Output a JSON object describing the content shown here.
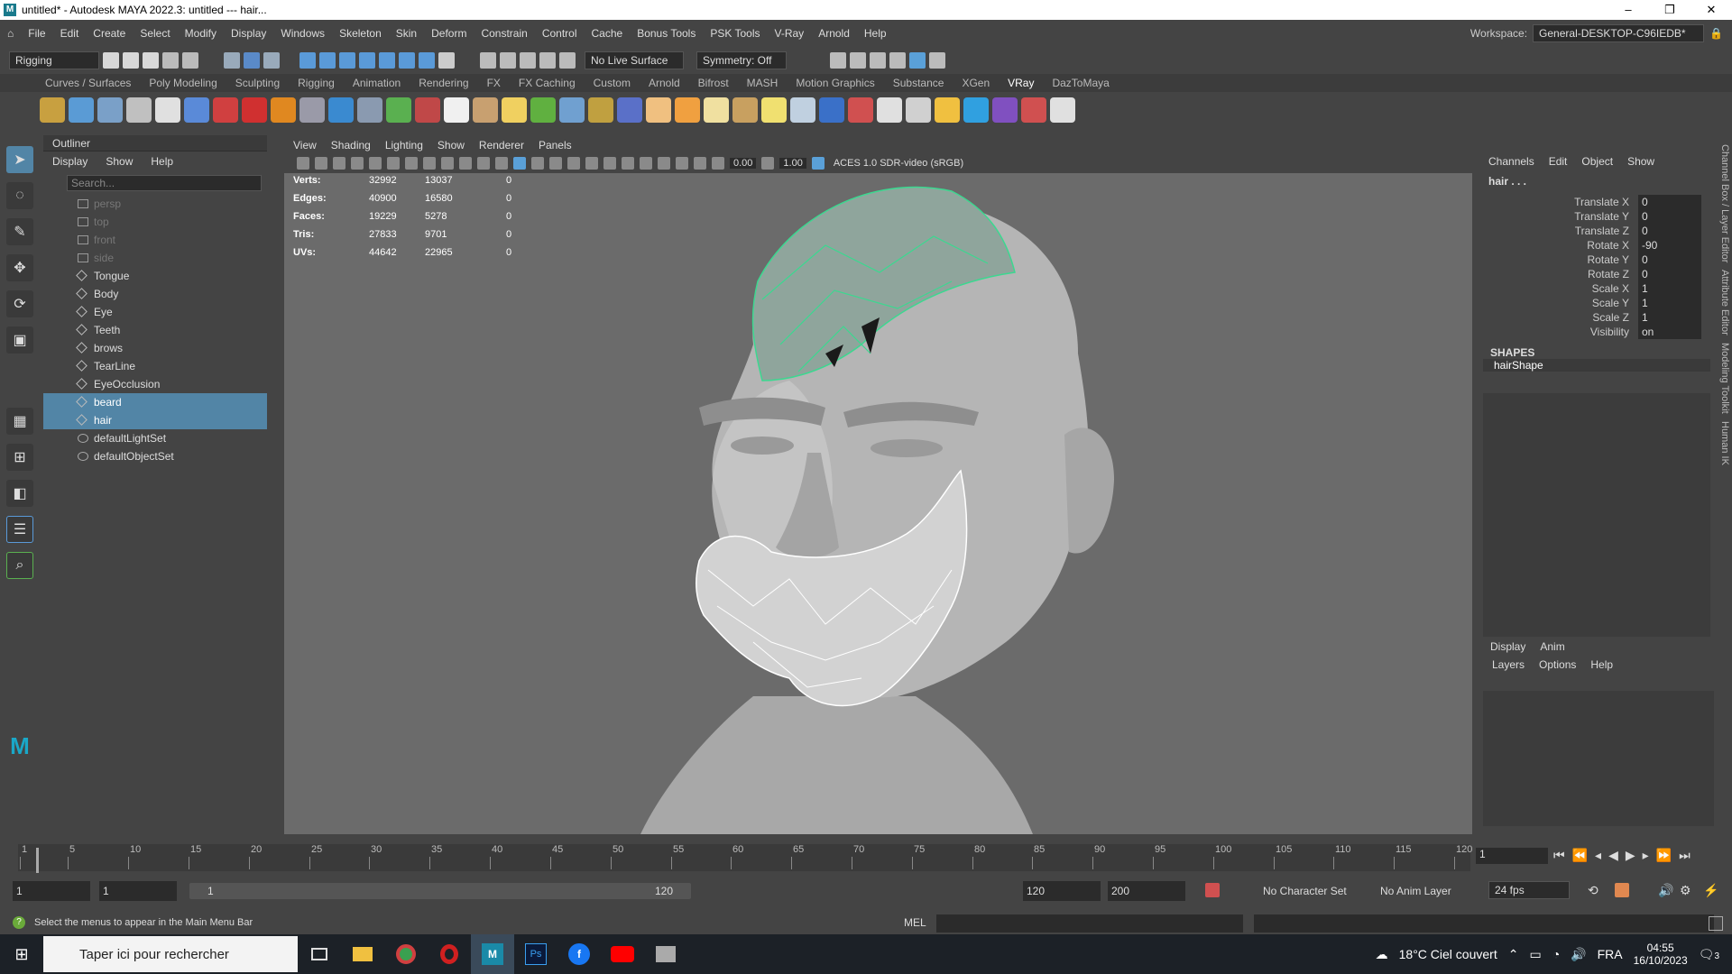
{
  "titlebar": {
    "title": "untitled* - Autodesk MAYA 2022.3: untitled   ---   hair...",
    "logo": "M"
  },
  "menubar": {
    "items": [
      "File",
      "Edit",
      "Create",
      "Select",
      "Modify",
      "Display",
      "Windows",
      "Skeleton",
      "Skin",
      "Deform",
      "Constrain",
      "Control",
      "Cache",
      "Bonus Tools",
      "PSK Tools",
      "V-Ray",
      "Arnold",
      "Help"
    ],
    "workspace_label": "Workspace:",
    "workspace_value": "General-DESKTOP-C96IEDB*"
  },
  "statusline": {
    "menuset": "Rigging",
    "live_surface": "No Live Surface",
    "symmetry": "Symmetry: Off"
  },
  "shelf": {
    "tabs": [
      "Curves / Surfaces",
      "Poly Modeling",
      "Sculpting",
      "Rigging",
      "Animation",
      "Rendering",
      "FX",
      "FX Caching",
      "Custom",
      "Arnold",
      "Bifrost",
      "MASH",
      "Motion Graphics",
      "Substance",
      "XGen",
      "VRay",
      "DazToMaya"
    ],
    "active": "VRay",
    "icon_colors": [
      "#c8a040",
      "#5a9bd5",
      "#7aa0c8",
      "#c0c0c0",
      "#e0e0e0",
      "#5a8ad8",
      "#d04040",
      "#d03030",
      "#e08820",
      "#9a9aa8",
      "#3a8ad0",
      "#8a9ab0",
      "#5ab050",
      "#c04848",
      "#f0f0f0",
      "#c8a070",
      "#f0d060",
      "#60b040",
      "#70a0d0",
      "#c0a040",
      "#5a70c8",
      "#f0c080",
      "#f0a040",
      "#f0e0a0",
      "#c8a060",
      "#f0e070",
      "#c0d0e0",
      "#3a70c8",
      "#d05050",
      "#e0e0e0",
      "#d0d0d0",
      "#f0c040",
      "#30a0e0",
      "#8050c0",
      "#d05050",
      "#e0e0e0"
    ]
  },
  "outliner": {
    "title": "Outliner",
    "menu": [
      "Display",
      "Show",
      "Help"
    ],
    "search_placeholder": "Search...",
    "items": [
      {
        "label": "persp",
        "type": "camera",
        "dim": true,
        "selected": false
      },
      {
        "label": "top",
        "type": "camera",
        "dim": true,
        "selected": false
      },
      {
        "label": "front",
        "type": "camera",
        "dim": true,
        "selected": false
      },
      {
        "label": "side",
        "type": "camera",
        "dim": true,
        "selected": false
      },
      {
        "label": "Tongue",
        "type": "mesh",
        "dim": false,
        "selected": false
      },
      {
        "label": "Body",
        "type": "mesh",
        "dim": false,
        "selected": false
      },
      {
        "label": "Eye",
        "type": "mesh",
        "dim": false,
        "selected": false
      },
      {
        "label": "Teeth",
        "type": "mesh",
        "dim": false,
        "selected": false
      },
      {
        "label": "brows",
        "type": "mesh",
        "dim": false,
        "selected": false
      },
      {
        "label": "TearLine",
        "type": "mesh",
        "dim": false,
        "selected": false
      },
      {
        "label": "EyeOcclusion",
        "type": "mesh",
        "dim": false,
        "selected": false
      },
      {
        "label": "beard",
        "type": "mesh",
        "dim": false,
        "selected": true
      },
      {
        "label": "hair",
        "type": "mesh",
        "dim": false,
        "selected": true
      },
      {
        "label": "defaultLightSet",
        "type": "set",
        "dim": false,
        "selected": false
      },
      {
        "label": "defaultObjectSet",
        "type": "set",
        "dim": false,
        "selected": false
      }
    ]
  },
  "viewport": {
    "menu": [
      "View",
      "Shading",
      "Lighting",
      "Show",
      "Renderer",
      "Panels"
    ],
    "exposure": "0.00",
    "gamma": "1.00",
    "color_space": "ACES 1.0 SDR-video (sRGB)",
    "hud": [
      {
        "label": "Verts:",
        "v1": "32992",
        "v2": "13037",
        "v3": "0"
      },
      {
        "label": "Edges:",
        "v1": "40900",
        "v2": "16580",
        "v3": "0"
      },
      {
        "label": "Faces:",
        "v1": "19229",
        "v2": "5278",
        "v3": "0"
      },
      {
        "label": "Tris:",
        "v1": "27833",
        "v2": "9701",
        "v3": "0"
      },
      {
        "label": "UVs:",
        "v1": "44642",
        "v2": "22965",
        "v3": "0"
      }
    ]
  },
  "channelbox": {
    "menu": [
      "Channels",
      "Edit",
      "Object",
      "Show"
    ],
    "object": "hair . . .",
    "attrs": [
      {
        "name": "Translate X",
        "value": "0"
      },
      {
        "name": "Translate Y",
        "value": "0"
      },
      {
        "name": "Translate Z",
        "value": "0"
      },
      {
        "name": "Rotate X",
        "value": "-90"
      },
      {
        "name": "Rotate Y",
        "value": "0"
      },
      {
        "name": "Rotate Z",
        "value": "0"
      },
      {
        "name": "Scale X",
        "value": "1"
      },
      {
        "name": "Scale Y",
        "value": "1"
      },
      {
        "name": "Scale Z",
        "value": "1"
      },
      {
        "name": "Visibility",
        "value": "on"
      }
    ],
    "shapes_label": "SHAPES",
    "shape_name": "hairShape"
  },
  "layereditor": {
    "tabs": [
      "Display",
      "Anim"
    ],
    "menu": [
      "Layers",
      "Options",
      "Help"
    ]
  },
  "sidetabs": [
    "Channel Box / Layer Editor",
    "Attribute Editor",
    "Modeling Toolkit",
    "Human IK"
  ],
  "timeline": {
    "ticks": [
      "1",
      "5",
      "10",
      "15",
      "20",
      "25",
      "30",
      "35",
      "40",
      "45",
      "50",
      "55",
      "60",
      "65",
      "70",
      "75",
      "80",
      "85",
      "90",
      "95",
      "100",
      "105",
      "110",
      "115",
      "120"
    ],
    "current_frame": "1"
  },
  "range": {
    "start": "1",
    "start_inner": "1",
    "slider_start": "1",
    "slider_end": "120",
    "end_inner": "120",
    "end": "200",
    "character_set": "No Character Set",
    "anim_layer": "No Anim Layer",
    "fps": "24 fps"
  },
  "cmdline": {
    "help_text": "Select the menus to appear in the Main Menu Bar",
    "lang": "MEL"
  },
  "taskbar": {
    "search_placeholder": "Taper ici pour rechercher",
    "weather": "18°C  Ciel couvert",
    "lang": "FRA",
    "time": "04:55",
    "date": "16/10/2023",
    "notifications": "3"
  }
}
